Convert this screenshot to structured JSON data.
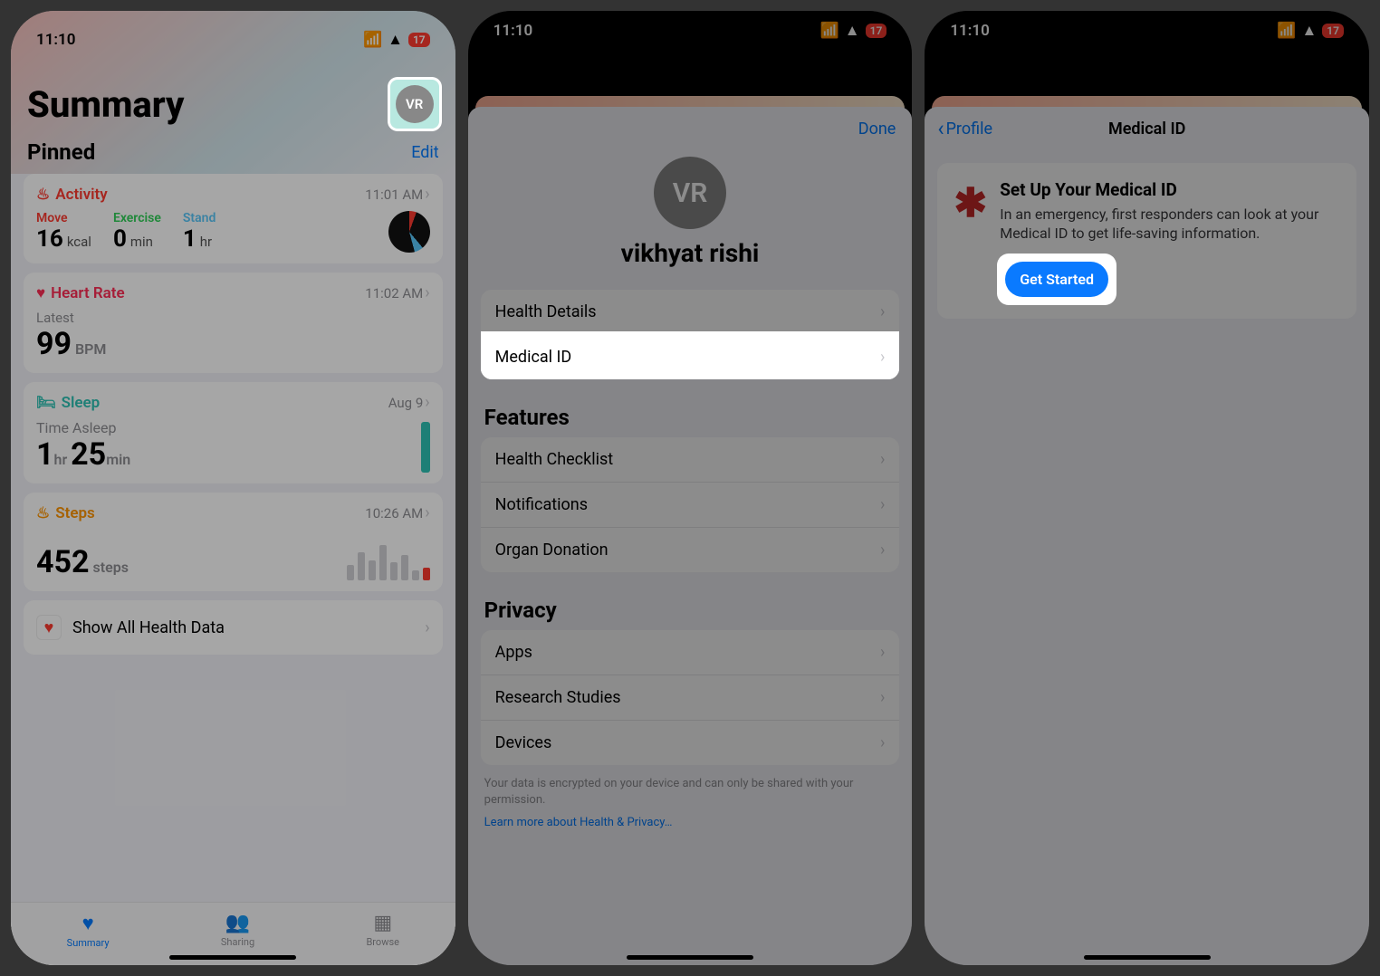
{
  "status": {
    "time": "11:10",
    "battery": "17"
  },
  "screen1": {
    "title": "Summary",
    "avatar_initials": "VR",
    "pinned": "Pinned",
    "edit": "Edit",
    "activity": {
      "label": "Activity",
      "time": "11:01 AM",
      "move_label": "Move",
      "move_val": "16",
      "move_unit": "kcal",
      "ex_label": "Exercise",
      "ex_val": "0",
      "ex_unit": "min",
      "stand_label": "Stand",
      "stand_val": "1",
      "stand_unit": "hr"
    },
    "heart": {
      "label": "Heart Rate",
      "time": "11:02 AM",
      "latest": "Latest",
      "val": "99",
      "unit": "BPM"
    },
    "sleep": {
      "label": "Sleep",
      "time": "Aug 9",
      "asleep": "Time Asleep",
      "h": "1",
      "hu": "hr",
      "m": "25",
      "mu": "min"
    },
    "steps": {
      "label": "Steps",
      "time": "10:26 AM",
      "val": "452",
      "unit": "steps"
    },
    "show_all": "Show All Health Data",
    "tabs": {
      "summary": "Summary",
      "sharing": "Sharing",
      "browse": "Browse"
    }
  },
  "screen2": {
    "done": "Done",
    "initials": "VR",
    "name": "vikhyat rishi",
    "health_details": "Health Details",
    "medical_id": "Medical ID",
    "features": "Features",
    "checklist": "Health Checklist",
    "notifications": "Notifications",
    "organ": "Organ Donation",
    "privacy": "Privacy",
    "apps": "Apps",
    "research": "Research Studies",
    "devices": "Devices",
    "note": "Your data is encrypted on your device and can only be shared with your permission.",
    "learn": "Learn more about Health & Privacy…"
  },
  "screen3": {
    "back": "Profile",
    "title": "Medical ID",
    "heading": "Set Up Your Medical ID",
    "body": "In an emergency, first responders can look at your Medical ID to get life-saving information.",
    "cta": "Get Started"
  },
  "colors": {
    "activity": "#ff3b30",
    "heart": "#ff2d55",
    "sleep": "#2ec4b6",
    "steps": "#ff9500"
  }
}
